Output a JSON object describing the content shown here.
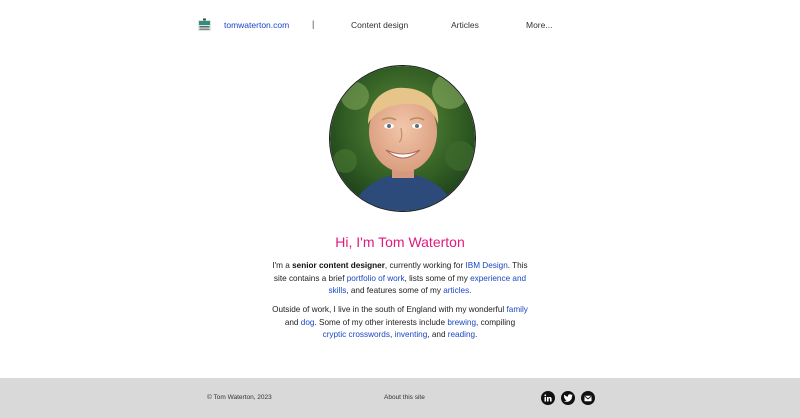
{
  "nav": {
    "site_name": "tomwaterton.com",
    "divider": "|",
    "items": [
      "Content design",
      "Articles",
      "More..."
    ]
  },
  "hero": {
    "title": "Hi, I'm Tom Waterton"
  },
  "bio": {
    "p1": {
      "t1": "I'm a ",
      "bold": "senior content designer",
      "t2": ", currently working for ",
      "link_ibm": "IBM Design",
      "t3": ". This site contains a brief ",
      "link_portfolio": "portfolio of work",
      "t4": ", lists some of my ",
      "link_experience": "experience and skills",
      "t5": ", and features some of my ",
      "link_articles": "articles",
      "t6": "."
    },
    "p2": {
      "t1": "Outside of work, I live in the south of England with my wonderful ",
      "link_family": "family",
      "t2": " and ",
      "link_dog": "dog",
      "t3": ". Some of my other interests include ",
      "link_brewing": "brewing",
      "t4": ", compiling ",
      "link_crosswords": "cryptic crosswords",
      "t5": ", ",
      "link_inventing": "inventing",
      "t6": ", and ",
      "link_reading": "reading",
      "t7": "."
    }
  },
  "footer": {
    "copyright": "© Tom Waterton, 2023",
    "about": "About this site",
    "social_icons": [
      "linkedin-icon",
      "twitter-icon",
      "email-icon"
    ]
  },
  "colors": {
    "accent": "#e0197d",
    "link": "#1a47c4",
    "footer_bg": "#d9d9d9"
  }
}
